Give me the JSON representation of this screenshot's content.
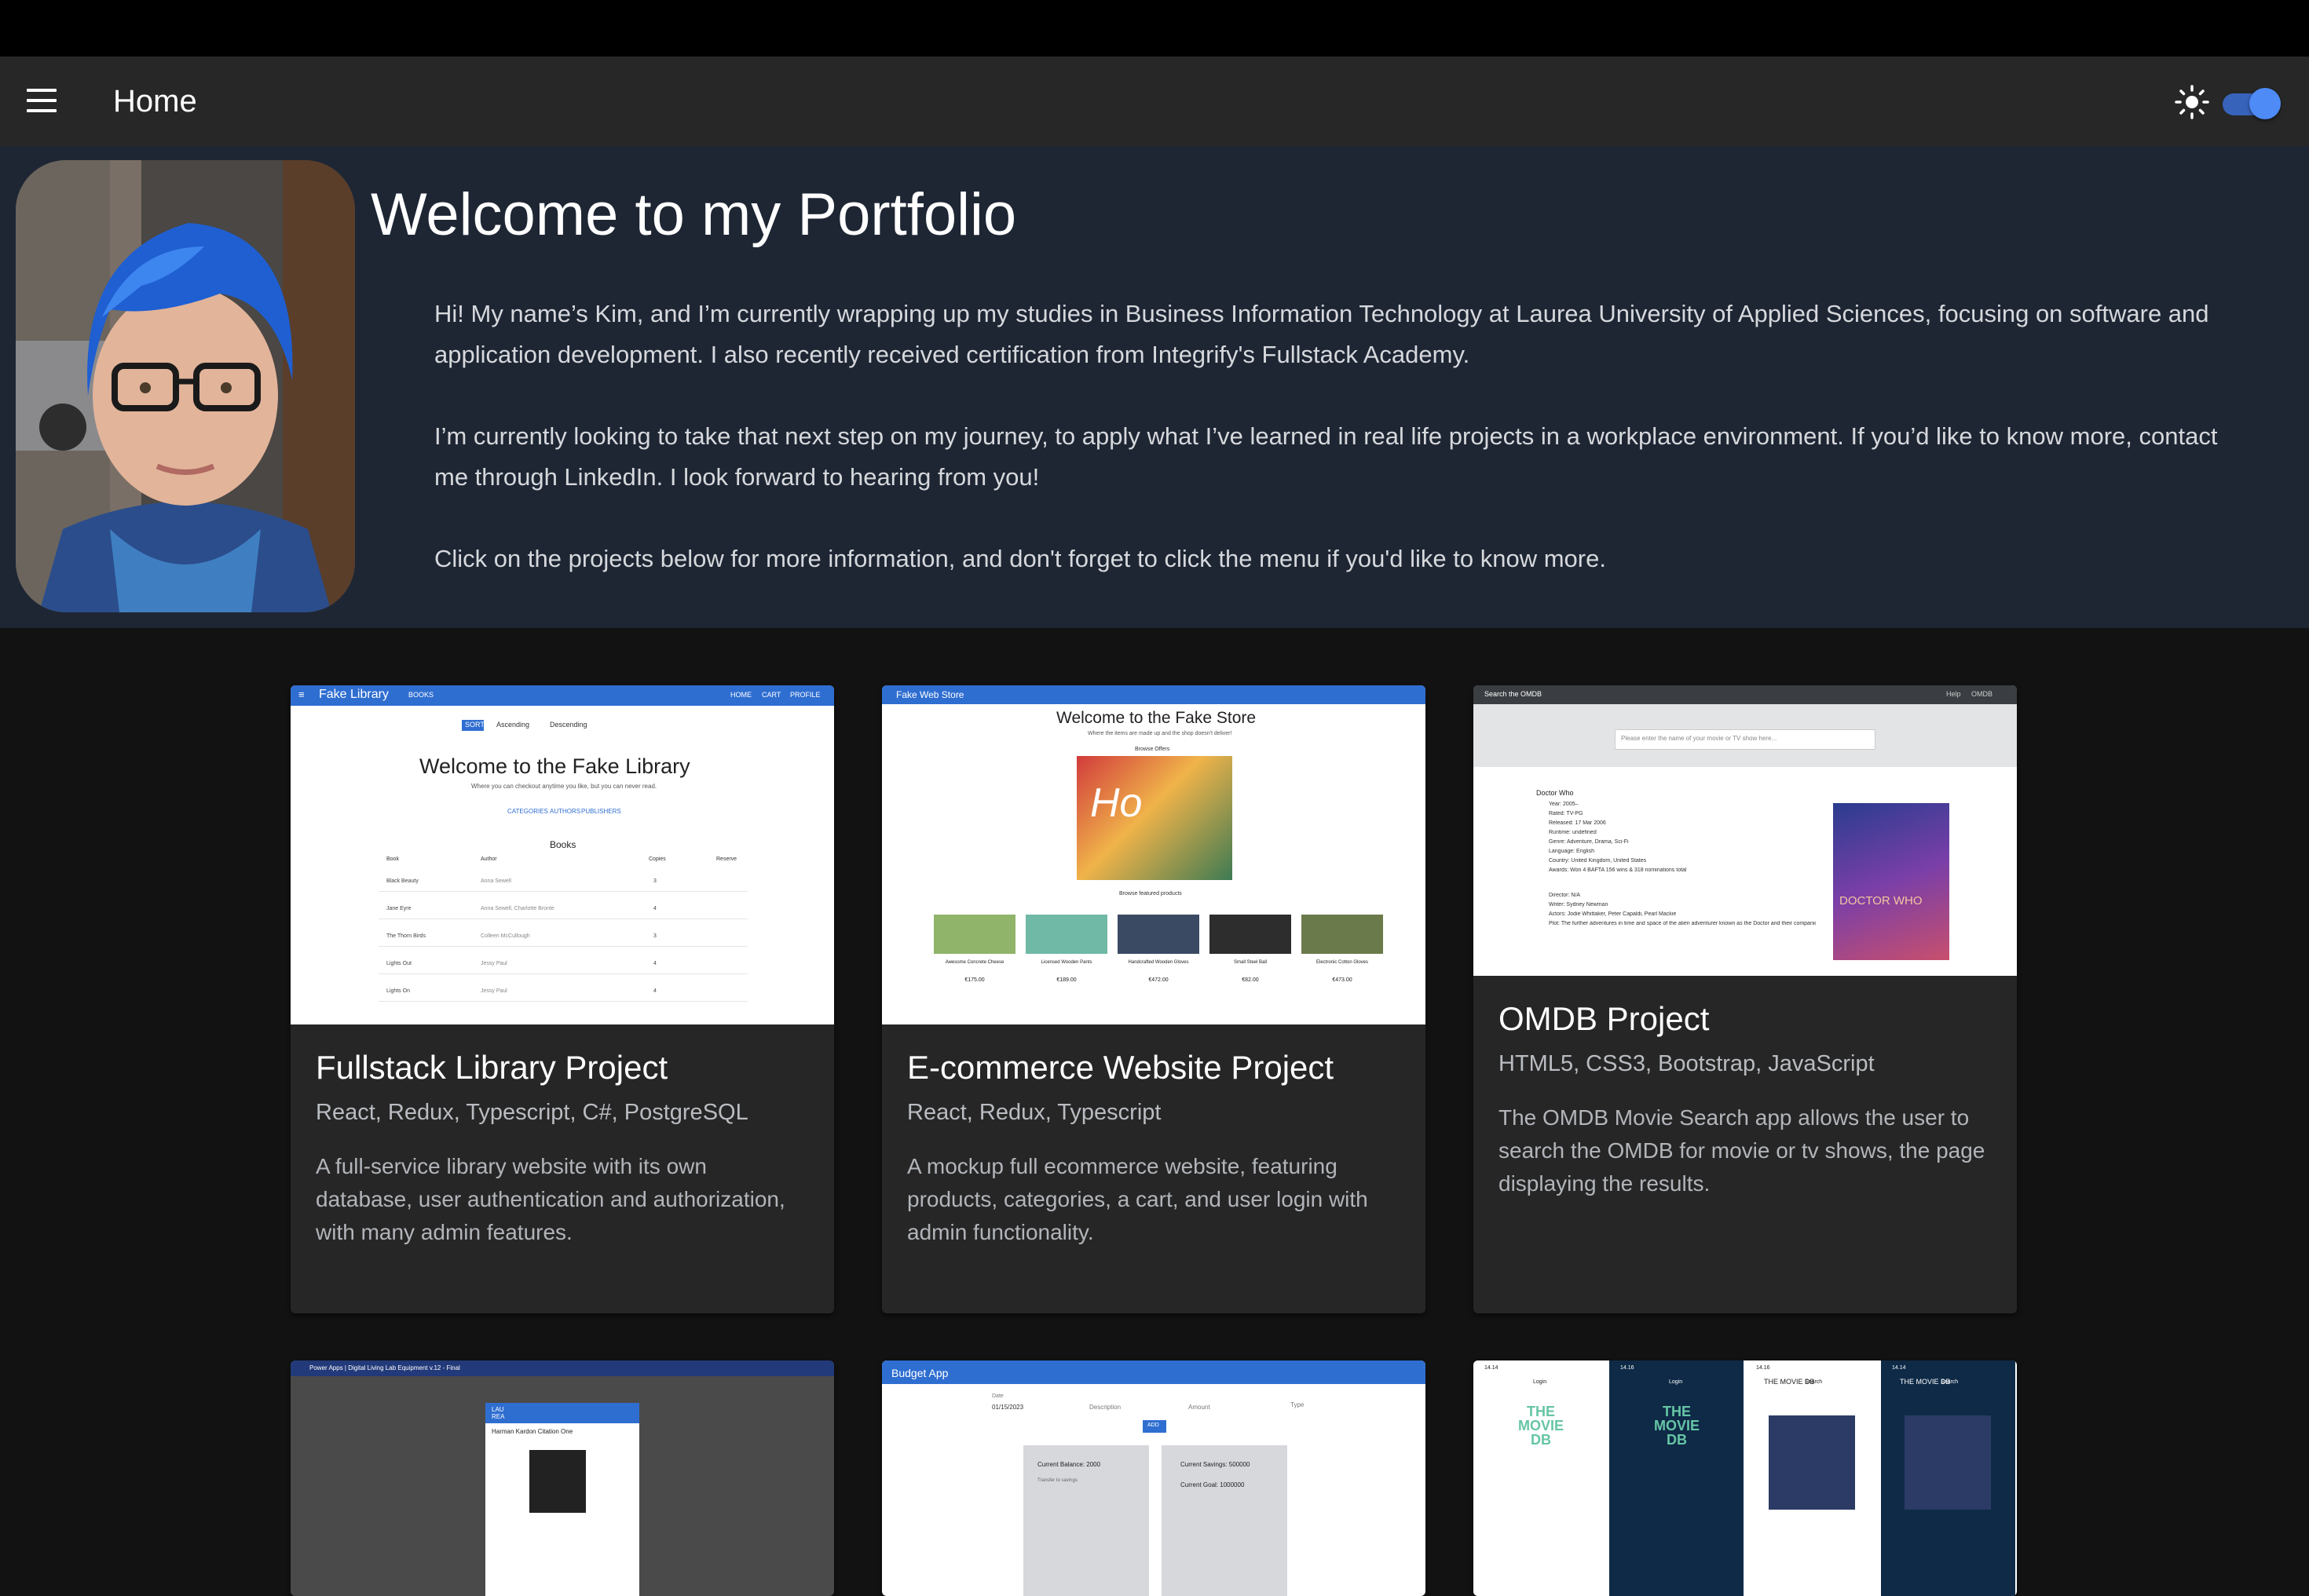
{
  "appbar": {
    "title": "Home"
  },
  "hero": {
    "title": "Welcome to my Portfolio",
    "paragraphs": [
      "Hi! My name’s Kim, and I’m currently wrapping up my studies in Business Information Technology at Laurea University of Applied Sciences, focusing on software and application development. I also recently received certification from Integrify's Fullstack Academy.",
      "I’m currently looking to take that next step on my journey, to apply what I’ve learned in real life projects in a workplace environment. If you’d like to know more, contact me through LinkedIn. I look forward to hearing from you!",
      "Click on the projects below for more information, and don't forget to click the menu if you'd like to know more."
    ]
  },
  "projects": [
    {
      "title": "Fullstack Library Project",
      "tech": "React, Redux, Typescript, C#, PostgreSQL",
      "description": "A full-service library website with its own database, user authentication and authorization, with many admin features.",
      "thumb": {
        "brand": "Fake Library",
        "nav": [
          "BOOKS",
          "HOME",
          "CART",
          "PROFILE"
        ],
        "heading": "Welcome to the Fake Library",
        "sub": "Where you can checkout anytime you like, but you can never read.",
        "links": [
          "CATEGORIES",
          "AUTHORS",
          "PUBLISHERS"
        ],
        "table_title": "Books",
        "columns": [
          "Book",
          "Author",
          "Copies",
          "Reserve"
        ],
        "rows": [
          [
            "Black Beauty",
            "Anna Sewell",
            "3"
          ],
          [
            "Jane Eyre",
            "Anna Sewell, Charlotte Bronte",
            "4"
          ],
          [
            "The Thorn Birds",
            "Colleen McCullough",
            "3"
          ],
          [
            "Lights Out",
            "Jessy Paul",
            "4"
          ],
          [
            "Lights On",
            "Jessy Paul",
            "4"
          ]
        ],
        "sort_label": "SORT",
        "asc": "Ascending",
        "desc": "Descending"
      }
    },
    {
      "title": "E-commerce Website Project",
      "tech": "React, Redux, Typescript",
      "description": "A mockup full ecommerce website, featuring products, categories, a cart, and user login with admin functionality.",
      "thumb": {
        "brand": "Fake Web Store",
        "heading": "Welcome to the Fake Store",
        "sub": "Where the items are made up and the shop doesn't deliver!",
        "offers": "Browse Offers",
        "featured": "Browse featured products",
        "products": [
          {
            "name": "Awesome Concrete Cheese",
            "price": "€175.00"
          },
          {
            "name": "Licensed Wooden Pants",
            "price": "€189.00"
          },
          {
            "name": "Handcrafted Wooden Gloves",
            "price": "€472.00"
          },
          {
            "name": "Small Steel Ball",
            "price": "€82.00"
          },
          {
            "name": "Electronic Cotton Gloves",
            "price": "€473.00"
          }
        ]
      }
    },
    {
      "title": "OMDB Project",
      "tech": "HTML5, CSS3, Bootstrap, JavaScript",
      "description": "The OMDB Movie Search app allows the user to search the OMDB for movie or tv shows, the page displaying the results.",
      "thumb": {
        "brand": "Search the OMDB",
        "nav": [
          "Help",
          "OMDB"
        ],
        "placeholder": "Please enter the name of your movie or TV show here...",
        "result_title": "Doctor Who",
        "details": [
          "Year: 2005–",
          "Rated: TV-PG",
          "Released: 17 Mar 2006",
          "Runtime: undefined",
          "Genre: Adventure, Drama, Sci-Fi",
          "Language: English",
          "Country: United Kingdom, United States",
          "Awards: Won 4 BAFTA 156 wins & 318 nominations total",
          "Director: N/A",
          "Writer: Sydney Newman",
          "Actors: Jodie Whittaker, Peter Capaldi, Pearl Mackie",
          "Plot: The further adventures in time and space of the alien adventurer known as the Doctor and their companions from planet Earth."
        ],
        "poster_title": "DOCTOR WHO"
      }
    },
    {
      "thumb": {
        "bar": "Power Apps | Digital Living Lab Equipment v.12 - Final",
        "logo": "LAU REA",
        "item": "Harman Kardon Citation One"
      }
    },
    {
      "thumb": {
        "brand": "Budget App",
        "fields": [
          "Date",
          "Description",
          "Amount",
          "Type"
        ],
        "date_value": "01/15/2023",
        "add": "ADD",
        "balance": "Current Balance: 2000",
        "savings": "Current Savings: 500000",
        "goal": "Current Goal: 1000000",
        "transfer": "Transfer to savings"
      }
    },
    {
      "thumb": {
        "screens": [
          {
            "time": "14.14",
            "label": "Login",
            "logo": "THE MOVIE DB"
          },
          {
            "time": "14.16",
            "label": "Login",
            "logo": "THE MOVIE DB"
          },
          {
            "time": "14.16",
            "label": "Search",
            "logo": "THE MOVIE DB"
          },
          {
            "time": "14.14",
            "label": "Search",
            "logo": "THE MOVIE DB"
          }
        ]
      }
    }
  ]
}
